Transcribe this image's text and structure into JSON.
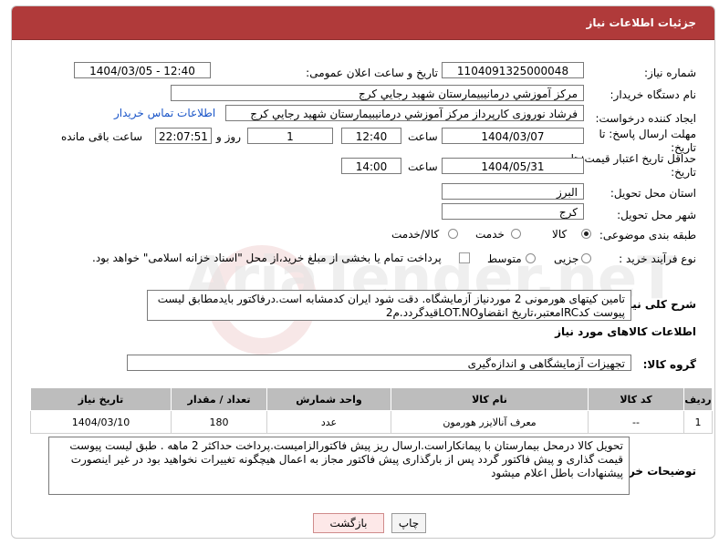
{
  "header": {
    "title": "جزئیات اطلاعات نیاز"
  },
  "watermark": "AriaTender.neT",
  "fields": {
    "need_number": {
      "label": "شماره نیاز:",
      "value": "1104091325000048"
    },
    "announce_date": {
      "label": "تاریخ و ساعت اعلان عمومی:",
      "value": "1404/03/05 - 12:40"
    },
    "buyer_org": {
      "label": "نام دستگاه خریدار:",
      "value": "مرکز آموزشي درمانيبيمارستان شهيد رجايي کرج"
    },
    "requester": {
      "label": "ایجاد کننده درخواست:",
      "value": "فرشاد نوروزی کارپرداز مرکز آموزشي درمانيبيمارستان شهيد رجايي کرج",
      "contact_link": "اطلاعات تماس خریدار"
    },
    "deadline": {
      "label": "مهلت ارسال پاسخ: تا تاریخ:",
      "date": "1404/03/07",
      "time_label": "ساعت",
      "time": "12:40",
      "days": "1",
      "days_label": "روز و",
      "remaining": "22:07:51",
      "remaining_label": "ساعت باقی مانده"
    },
    "validity": {
      "label": "حداقل تاریخ اعتبار قیمت: تا تاریخ:",
      "date": "1404/05/31",
      "time_label": "ساعت",
      "time": "14:00"
    },
    "province": {
      "label": "استان محل تحویل:",
      "value": "البرز"
    },
    "city": {
      "label": "شهر محل تحویل:",
      "value": "کرج"
    },
    "category": {
      "label": "طبقه بندی موضوعی:",
      "options": [
        "کالا",
        "خدمت",
        "کالا/خدمت"
      ],
      "selected": 0
    },
    "process": {
      "label": "نوع فرآیند خرید :",
      "options": [
        "جزیی",
        "متوسط"
      ],
      "selected": -1,
      "payment_note": "پرداخت تمام یا بخشی از مبلغ خرید،از محل \"اسناد خزانه اسلامی\" خواهد بود."
    }
  },
  "summary": {
    "label": "شرح کلی نیاز:",
    "text": "تامین کیتهای هورمونی 2 موردنیاز آزمایشگاه. دقت شود ایران کدمشابه است.درفاکتور بایدمطابق لیست پیوست کدIRCمعتبر،تاریخ انقضاوLOT.NOقیدگردد.م2"
  },
  "goods_section": {
    "title": "اطلاعات کالاهای مورد نیاز",
    "group_label": "گروه کالا:",
    "group_value": "تجهیزات آزمایشگاهی و اندازه‌گیری"
  },
  "table": {
    "headers": [
      "ردیف",
      "کد کالا",
      "نام کالا",
      "واحد شمارش",
      "تعداد / مقدار",
      "تاریخ نیاز"
    ],
    "rows": [
      [
        "1",
        "--",
        "معرف آنالایزر هورمون",
        "عدد",
        "180",
        "1404/03/10"
      ]
    ]
  },
  "buyer_notes": {
    "label": "توضیحات خریدار:",
    "text": "تحویل کالا درمحل بیمارستان با پیمانکاراست.ارسال ریز پیش فاکتورالزامیست.پرداخت حداکثر 2 ماهه . طبق لیست پیوست قیمت گذاری و پیش فاکتور گردد پس از بارگذاری پیش فاکتور مجاز به اعمال هیچگونه تغییرات نخواهید بود در غیر اینصورت پیشنهادات باطل اعلام میشود"
  },
  "buttons": {
    "print": "چاپ",
    "back": "بازگشت"
  }
}
